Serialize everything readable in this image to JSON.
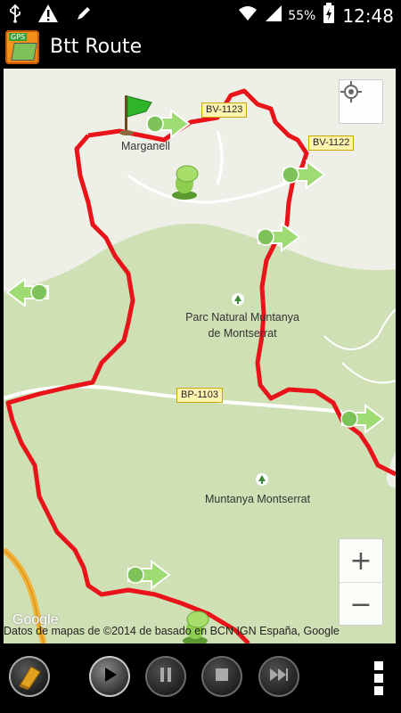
{
  "status_bar": {
    "battery_percent": "55%",
    "time": "12:48",
    "icons": [
      "usb-icon",
      "warning-icon",
      "edit-icon",
      "wifi-icon",
      "signal-icon",
      "battery-charging-icon"
    ]
  },
  "app": {
    "title": "Btt Route",
    "icon_badge": "GPS"
  },
  "map": {
    "road_labels": [
      "BV-1123",
      "BV-1122",
      "BP-1103"
    ],
    "places": [
      "Marganell",
      "Parc Natural Muntanya",
      "de Montserrat",
      "Muntanya Montserrat"
    ],
    "attribution": "Datos de mapas de ©2014 de basado en BCN IGN España, Google",
    "google_logo": "Google",
    "zoom_in_label": "+",
    "zoom_out_label": "−",
    "colors": {
      "route": "#e8141a",
      "park": "#cfe0b5",
      "land": "#eef0e8",
      "road": "#ffffff",
      "highway": "#f2b23a"
    }
  },
  "toolbar": {
    "buttons": [
      "route-menu-button",
      "play-button",
      "pause-button",
      "stop-button",
      "fast-forward-button",
      "overflow-menu-button"
    ]
  }
}
